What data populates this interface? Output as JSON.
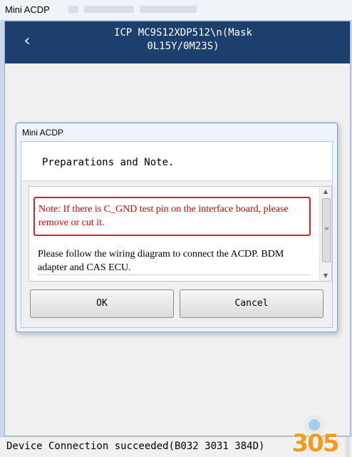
{
  "outer_window": {
    "title": "Mini ACDP"
  },
  "header": {
    "back_icon": "chevron-left-icon",
    "title": "ICP MC9S12XDP512\\n(Mask\n0L15Y/0M23S)"
  },
  "dialog": {
    "title": "Mini ACDP",
    "heading": "Preparations and Note.",
    "note": "Note: If there is C_GND test pin on the interface board, please remove or cut it.",
    "body": "Please follow the wiring diagram to connect the ACDP. BDM adapter and CAS ECU.",
    "ok_label": "OK",
    "cancel_label": "Cancel"
  },
  "status": {
    "text": "Device Connection succeeded(B032 3031 384D)"
  },
  "watermark": {
    "text": "305"
  },
  "colors": {
    "header_bg": "#1d3f6e",
    "note_red": "#e00000",
    "watermark_orange": "#f39a1f"
  }
}
